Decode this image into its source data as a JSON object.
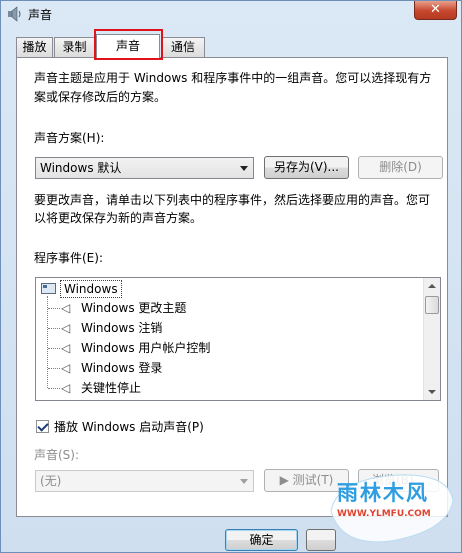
{
  "window": {
    "title": "声音",
    "close_glyph": "✕"
  },
  "tabs": [
    {
      "label": "播放",
      "active": false
    },
    {
      "label": "录制",
      "active": false
    },
    {
      "label": "声音",
      "active": true
    },
    {
      "label": "通信",
      "active": false
    }
  ],
  "sounds_page": {
    "description": "声音主题是应用于 Windows 和程序事件中的一组声音。您可以选择现有方\n案或保存修改后的方案。",
    "description_line1": "声音主题是应用于 Windows 和程序事件中的一组声音。您可以选择现有方",
    "description_line2": "案或保存修改后的方案。",
    "scheme_label": "声音方案(H):",
    "scheme_value": "Windows 默认",
    "save_as_label": "另存为(V)...",
    "delete_label": "删除(D)",
    "instruction_line1": "要更改声音，请单击以下列表中的程序事件，然后选择要应用的声音。您可",
    "instruction_line2": "以将更改保存为新的声音方案。",
    "events_label": "程序事件(E):",
    "events_root": "Windows",
    "events": [
      "Windows 更改主题",
      "Windows 注销",
      "Windows 用户帐户控制",
      "Windows 登录",
      "关键性停止"
    ],
    "startup_sound_label": "播放 Windows 启动声音(P)",
    "startup_sound_checked": true,
    "sound_label": "声音(S):",
    "sound_value": "(无)",
    "test_label": "▶ 测试(T)",
    "browse_label": "浏览(B)..."
  },
  "footer": {
    "ok_label": "确定"
  },
  "watermark": {
    "title": "雨林木风",
    "url": "WWW.YLMFU.COM"
  },
  "colors": {
    "highlight_box": "#e0131a",
    "watermark_blue": "#2f9de0",
    "watermark_red": "#e0432f"
  }
}
